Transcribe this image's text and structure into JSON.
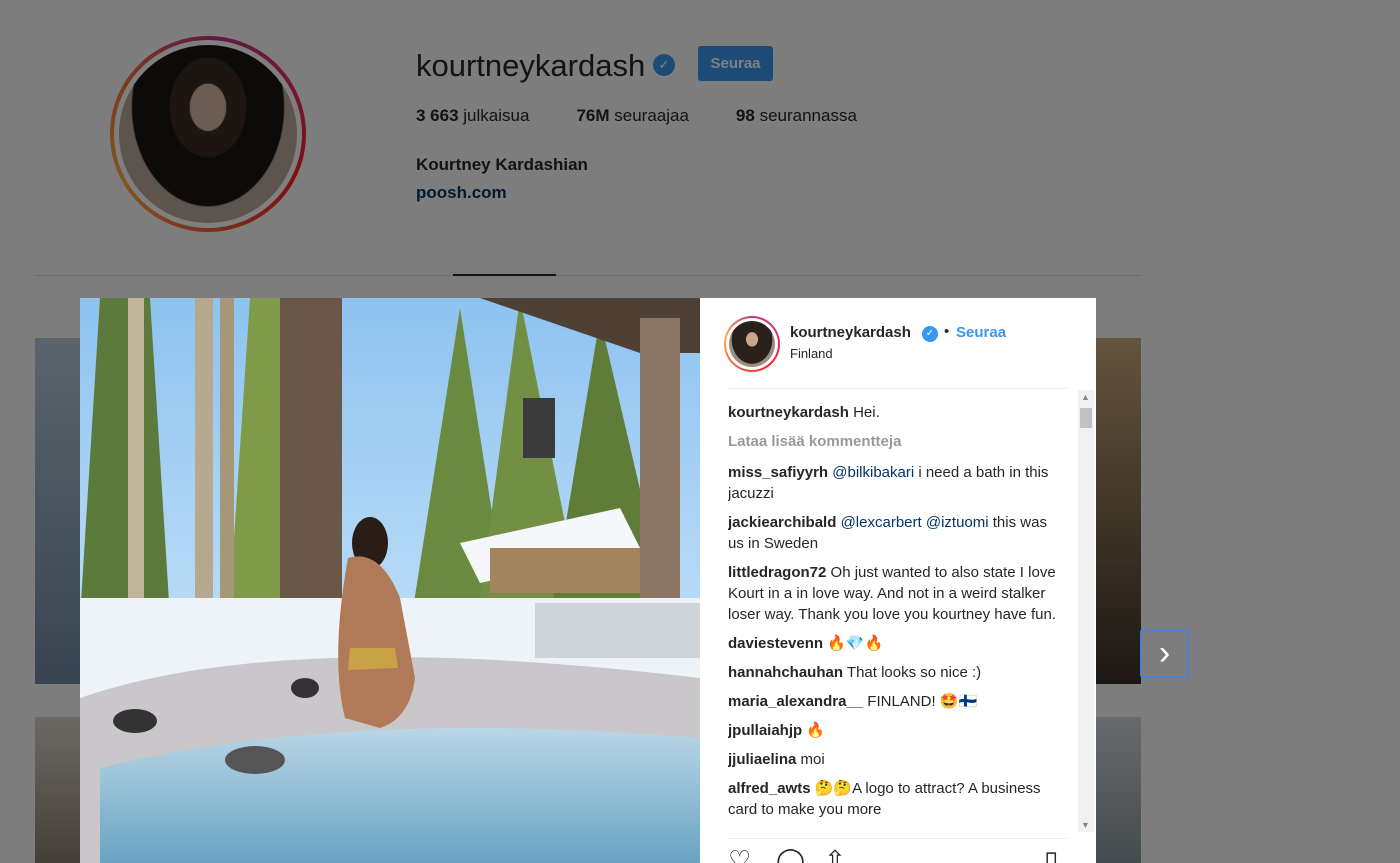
{
  "profile": {
    "username": "kourtneykardash",
    "follow_label": "Seuraa",
    "posts_count": "3 663",
    "posts_label": "julkaisua",
    "followers_count": "76M",
    "followers_label": "seuraajaa",
    "following_count": "98",
    "following_label": "seurannassa",
    "full_name": "Kourtney Kardashian",
    "website": "poosh.com"
  },
  "post": {
    "username": "kourtneykardash",
    "separator": "•",
    "follow_label": "Seuraa",
    "location": "Finland",
    "load_more": "Lataa lisää kommentteja",
    "comments": [
      {
        "user": "kourtneykardash",
        "text": "Hei."
      },
      {
        "user": "miss_safiyyrh",
        "mentions": [
          "@bilkibakari"
        ],
        "text": "i need a bath in this jacuzzi"
      },
      {
        "user": "jackiearchibald",
        "mentions": [
          "@lexcarbert",
          "@iztuomi"
        ],
        "text": "this was us in Sweden"
      },
      {
        "user": "littledragon72",
        "text": "Oh just wanted to also state I love Kourt in a in love way. And not in a weird stalker loser way. Thank you love you kourtney have fun."
      },
      {
        "user": "daviestevenn",
        "text": "🔥💎🔥"
      },
      {
        "user": "hannahchauhan",
        "text": "That looks so nice :)"
      },
      {
        "user": "maria_alexandra__",
        "text": "FINLAND! 🤩🇫🇮"
      },
      {
        "user": "jpullaiahjp",
        "text": "🔥"
      },
      {
        "user": "jjuliaelina",
        "text": "moi"
      },
      {
        "user": "alfred_awts",
        "text": "🤔🤔A logo to attract? A business card to make you more"
      }
    ]
  },
  "colors": {
    "accent": "#3897f0",
    "link": "#003569",
    "overlay": "rgba(0,0,0,0.5)"
  },
  "icons": [
    "verified-badge-icon",
    "chevron-right-icon",
    "heart-icon",
    "comment-icon",
    "share-icon",
    "bookmark-icon"
  ]
}
